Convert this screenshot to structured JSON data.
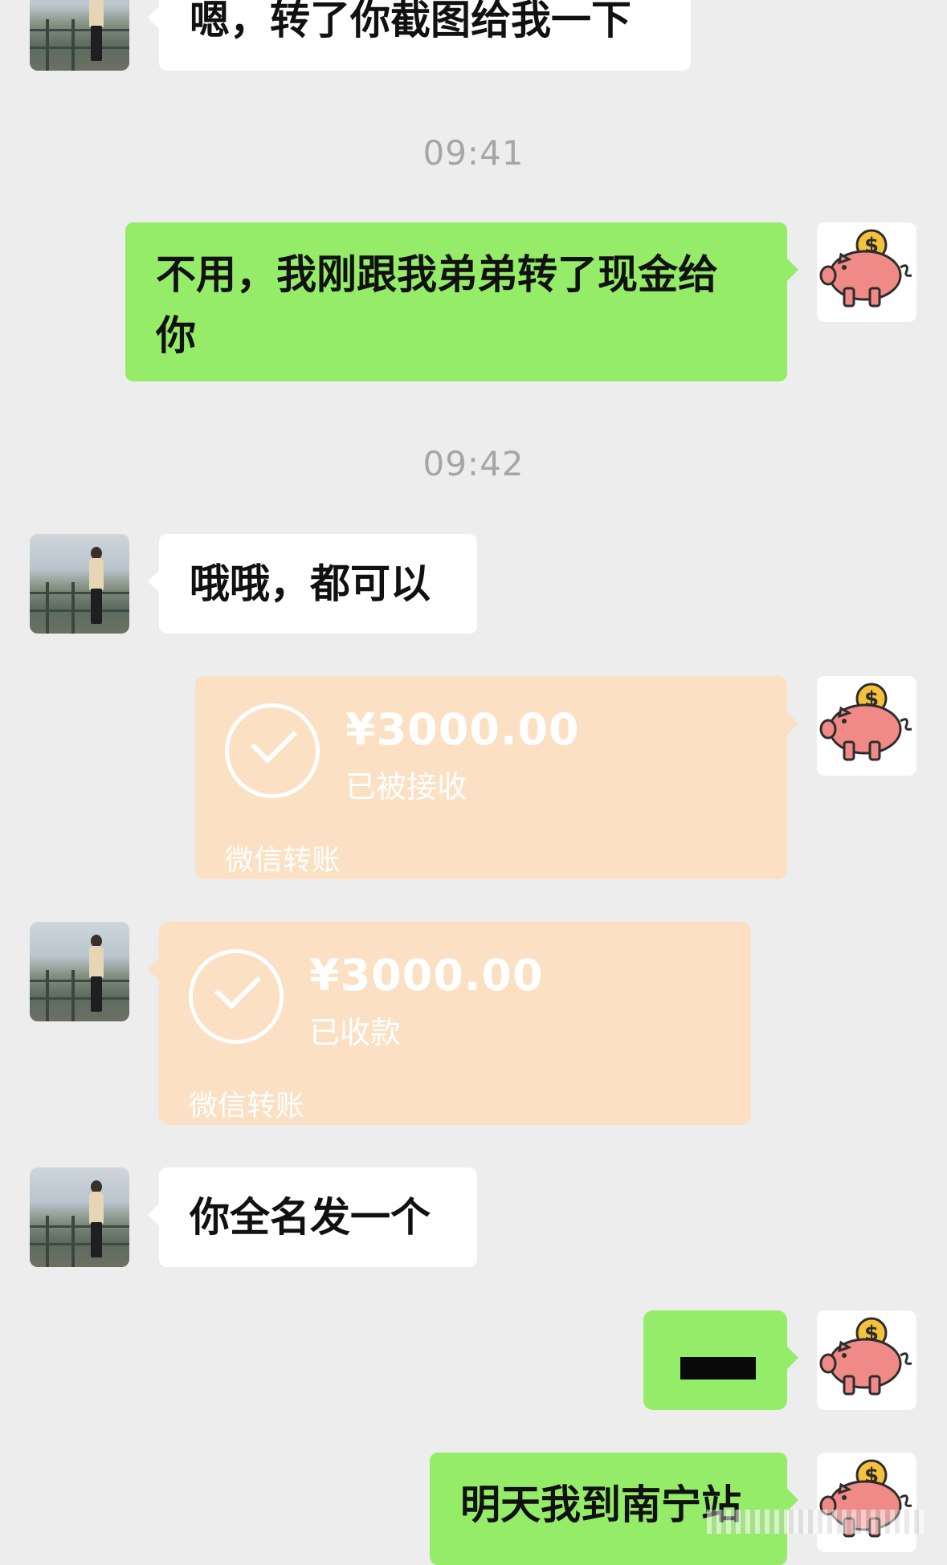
{
  "messages": {
    "m1": "嗯，转了你截图给我一下",
    "t1": "09:41",
    "m2_line1": "不用，我刚跟我弟弟转了现金给",
    "m2_line2": "你",
    "t2": "09:42",
    "m3": "哦哦，都可以",
    "m6": "你全名发一个",
    "m8": "明天我到南宁站"
  },
  "transfer_sent": {
    "amount": "¥3000.00",
    "status": "已被接收",
    "label": "微信转账"
  },
  "transfer_received": {
    "amount": "¥3000.00",
    "status": "已收款",
    "label": "微信转账"
  },
  "icons": {
    "friend_avatar": "photo-avatar",
    "self_avatar": "piggy-bank-icon"
  },
  "colors": {
    "background": "#ededed",
    "incoming_bubble": "#ffffff",
    "outgoing_bubble": "#95ec69",
    "transfer_card": "#fbe0c3",
    "timestamp": "#a6a6a6"
  }
}
